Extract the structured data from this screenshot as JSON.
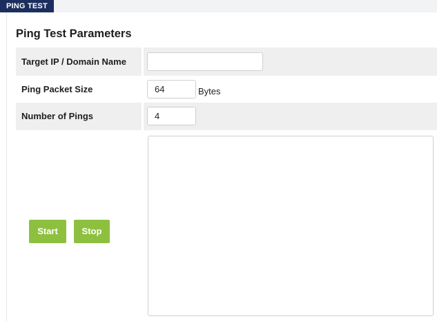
{
  "tab": {
    "label": "PING TEST"
  },
  "section": {
    "title": "Ping Test Parameters"
  },
  "fields": {
    "target": {
      "label": "Target IP / Domain Name",
      "value": ""
    },
    "packet_size": {
      "label": "Ping Packet Size",
      "value": "64",
      "unit": "Bytes"
    },
    "num_pings": {
      "label": "Number of Pings",
      "value": "4"
    }
  },
  "buttons": {
    "start": "Start",
    "stop": "Stop"
  },
  "output": {
    "value": ""
  },
  "colors": {
    "tab_bg": "#1b2f5e",
    "button_bg": "#8dc03f",
    "row_shade": "#efefef"
  }
}
